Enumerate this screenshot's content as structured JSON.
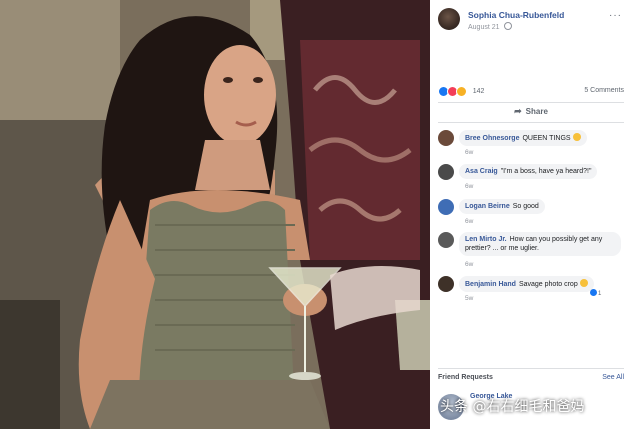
{
  "post": {
    "author": "Sophia Chua-Rubenfeld",
    "date": "August 21",
    "more": "···",
    "reaction_count": "142",
    "comments_count": "5 Comments",
    "share_label": "Share"
  },
  "comments": [
    {
      "name": "Bree Ohnesorge",
      "text": "QUEEN TINGS",
      "time": "6w",
      "has_emoji": true
    },
    {
      "name": "Asa Craig",
      "text": "\"I'm a boss, have ya heard?!\"",
      "time": "6w"
    },
    {
      "name": "Logan Beirne",
      "text": "So good",
      "time": "6w"
    },
    {
      "name": "Len Mirto Jr.",
      "text": "How can you possibly get any prettier? ... or me uglier.",
      "time": "6w"
    },
    {
      "name": "Benjamin Hand",
      "text": "Savage photo crop",
      "time": "5w",
      "has_emoji": true,
      "reactions": "1"
    }
  ],
  "friend_requests": {
    "title": "Friend Requests",
    "see_all": "See All",
    "first_name": "George Lake"
  },
  "watermark": "头条 @右右细毛和爸妈",
  "colors": {
    "link_blue": "#385898",
    "like_blue": "#1877f2",
    "panel_bg": "#ffffff",
    "comment_bg": "#f2f3f5"
  }
}
